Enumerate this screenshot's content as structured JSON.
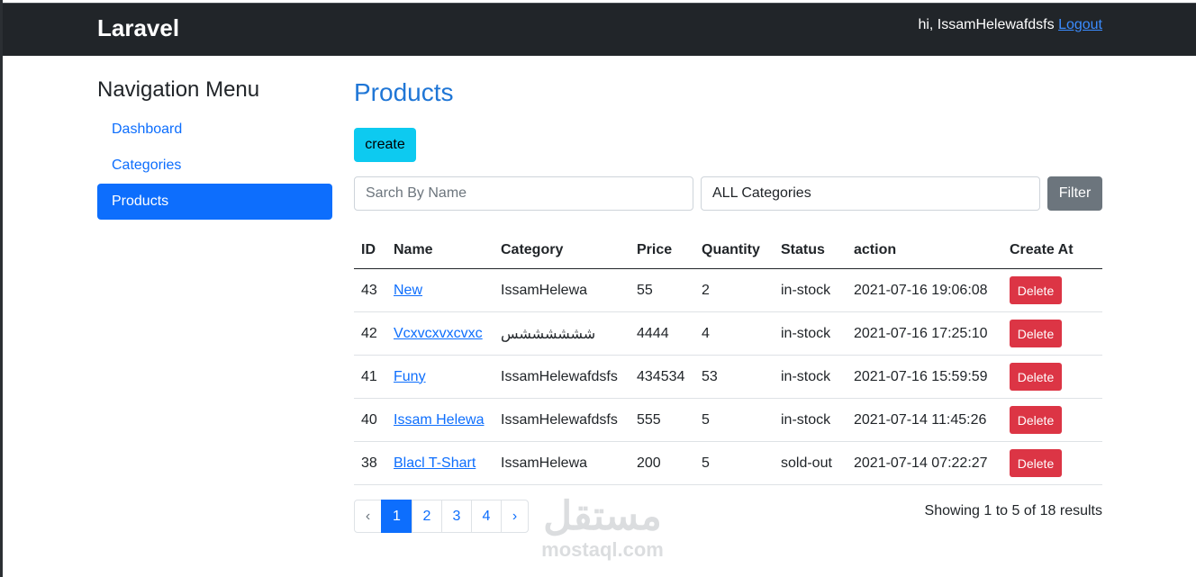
{
  "navbar": {
    "brand": "Laravel",
    "greeting": "hi, IssamHelewafdsfs",
    "logout": "Logout"
  },
  "sidebar": {
    "title": "Navigation Menu",
    "items": [
      {
        "label": "Dashboard",
        "active": false
      },
      {
        "label": "Categories",
        "active": false
      },
      {
        "label": "Products",
        "active": true
      }
    ]
  },
  "main": {
    "title": "Products",
    "create_label": "create",
    "search": {
      "placeholder": "Sarch By Name",
      "value": ""
    },
    "category_select": {
      "value": "ALL Categories"
    },
    "filter_label": "Filter",
    "columns": [
      "ID",
      "Name",
      "Category",
      "Price",
      "Quantity",
      "Status",
      "action",
      "Create At"
    ],
    "delete_label": "Delete",
    "rows": [
      {
        "id": "43",
        "name": "New",
        "category": "IssamHelewa",
        "price": "55",
        "quantity": "2",
        "status": "in-stock",
        "created": "2021-07-16 19:06:08"
      },
      {
        "id": "42",
        "name": "Vcxvcxvxcvxc",
        "category": "ششششششس",
        "price": "4444",
        "quantity": "4",
        "status": "in-stock",
        "created": "2021-07-16 17:25:10"
      },
      {
        "id": "41",
        "name": "Funy",
        "category": "IssamHelewafdsfs",
        "price": "434534",
        "quantity": "53",
        "status": "in-stock",
        "created": "2021-07-16 15:59:59"
      },
      {
        "id": "40",
        "name": "Issam Helewa",
        "category": "IssamHelewafdsfs",
        "price": "555",
        "quantity": "5",
        "status": "in-stock",
        "created": "2021-07-14 11:45:26"
      },
      {
        "id": "38",
        "name": "Blacl T-Shart",
        "category": "IssamHelewa",
        "price": "200",
        "quantity": "5",
        "status": "sold-out",
        "created": "2021-07-14 07:22:27"
      }
    ],
    "pagination": {
      "prev": "‹",
      "pages": [
        "1",
        "2",
        "3",
        "4"
      ],
      "next": "›",
      "current": "1"
    },
    "results_text": "Showing 1 to 5 of 18 results"
  },
  "watermark": {
    "arabic": "مستقل",
    "latin": "mostaql.com"
  }
}
